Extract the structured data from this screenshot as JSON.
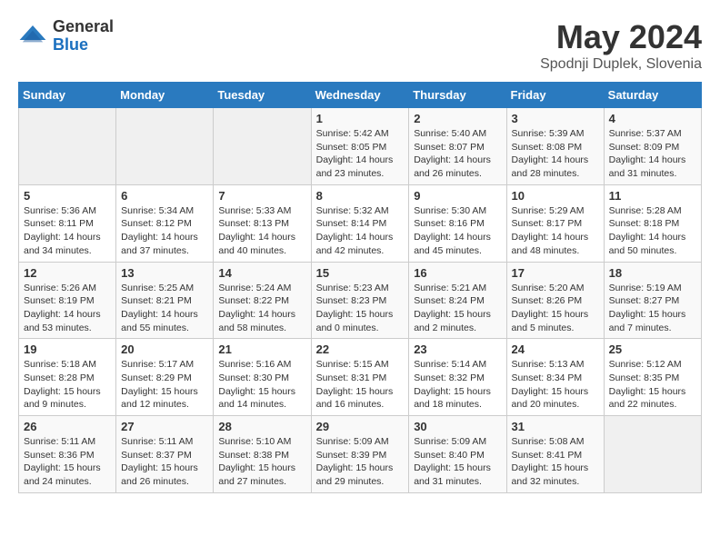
{
  "header": {
    "logo_general": "General",
    "logo_blue": "Blue",
    "title": "May 2024",
    "subtitle": "Spodnji Duplek, Slovenia"
  },
  "days_of_week": [
    "Sunday",
    "Monday",
    "Tuesday",
    "Wednesday",
    "Thursday",
    "Friday",
    "Saturday"
  ],
  "weeks": [
    [
      {
        "day": "",
        "sunrise": "",
        "sunset": "",
        "daylight": ""
      },
      {
        "day": "",
        "sunrise": "",
        "sunset": "",
        "daylight": ""
      },
      {
        "day": "",
        "sunrise": "",
        "sunset": "",
        "daylight": ""
      },
      {
        "day": "1",
        "sunrise": "Sunrise: 5:42 AM",
        "sunset": "Sunset: 8:05 PM",
        "daylight": "Daylight: 14 hours and 23 minutes."
      },
      {
        "day": "2",
        "sunrise": "Sunrise: 5:40 AM",
        "sunset": "Sunset: 8:07 PM",
        "daylight": "Daylight: 14 hours and 26 minutes."
      },
      {
        "day": "3",
        "sunrise": "Sunrise: 5:39 AM",
        "sunset": "Sunset: 8:08 PM",
        "daylight": "Daylight: 14 hours and 28 minutes."
      },
      {
        "day": "4",
        "sunrise": "Sunrise: 5:37 AM",
        "sunset": "Sunset: 8:09 PM",
        "daylight": "Daylight: 14 hours and 31 minutes."
      }
    ],
    [
      {
        "day": "5",
        "sunrise": "Sunrise: 5:36 AM",
        "sunset": "Sunset: 8:11 PM",
        "daylight": "Daylight: 14 hours and 34 minutes."
      },
      {
        "day": "6",
        "sunrise": "Sunrise: 5:34 AM",
        "sunset": "Sunset: 8:12 PM",
        "daylight": "Daylight: 14 hours and 37 minutes."
      },
      {
        "day": "7",
        "sunrise": "Sunrise: 5:33 AM",
        "sunset": "Sunset: 8:13 PM",
        "daylight": "Daylight: 14 hours and 40 minutes."
      },
      {
        "day": "8",
        "sunrise": "Sunrise: 5:32 AM",
        "sunset": "Sunset: 8:14 PM",
        "daylight": "Daylight: 14 hours and 42 minutes."
      },
      {
        "day": "9",
        "sunrise": "Sunrise: 5:30 AM",
        "sunset": "Sunset: 8:16 PM",
        "daylight": "Daylight: 14 hours and 45 minutes."
      },
      {
        "day": "10",
        "sunrise": "Sunrise: 5:29 AM",
        "sunset": "Sunset: 8:17 PM",
        "daylight": "Daylight: 14 hours and 48 minutes."
      },
      {
        "day": "11",
        "sunrise": "Sunrise: 5:28 AM",
        "sunset": "Sunset: 8:18 PM",
        "daylight": "Daylight: 14 hours and 50 minutes."
      }
    ],
    [
      {
        "day": "12",
        "sunrise": "Sunrise: 5:26 AM",
        "sunset": "Sunset: 8:19 PM",
        "daylight": "Daylight: 14 hours and 53 minutes."
      },
      {
        "day": "13",
        "sunrise": "Sunrise: 5:25 AM",
        "sunset": "Sunset: 8:21 PM",
        "daylight": "Daylight: 14 hours and 55 minutes."
      },
      {
        "day": "14",
        "sunrise": "Sunrise: 5:24 AM",
        "sunset": "Sunset: 8:22 PM",
        "daylight": "Daylight: 14 hours and 58 minutes."
      },
      {
        "day": "15",
        "sunrise": "Sunrise: 5:23 AM",
        "sunset": "Sunset: 8:23 PM",
        "daylight": "Daylight: 15 hours and 0 minutes."
      },
      {
        "day": "16",
        "sunrise": "Sunrise: 5:21 AM",
        "sunset": "Sunset: 8:24 PM",
        "daylight": "Daylight: 15 hours and 2 minutes."
      },
      {
        "day": "17",
        "sunrise": "Sunrise: 5:20 AM",
        "sunset": "Sunset: 8:26 PM",
        "daylight": "Daylight: 15 hours and 5 minutes."
      },
      {
        "day": "18",
        "sunrise": "Sunrise: 5:19 AM",
        "sunset": "Sunset: 8:27 PM",
        "daylight": "Daylight: 15 hours and 7 minutes."
      }
    ],
    [
      {
        "day": "19",
        "sunrise": "Sunrise: 5:18 AM",
        "sunset": "Sunset: 8:28 PM",
        "daylight": "Daylight: 15 hours and 9 minutes."
      },
      {
        "day": "20",
        "sunrise": "Sunrise: 5:17 AM",
        "sunset": "Sunset: 8:29 PM",
        "daylight": "Daylight: 15 hours and 12 minutes."
      },
      {
        "day": "21",
        "sunrise": "Sunrise: 5:16 AM",
        "sunset": "Sunset: 8:30 PM",
        "daylight": "Daylight: 15 hours and 14 minutes."
      },
      {
        "day": "22",
        "sunrise": "Sunrise: 5:15 AM",
        "sunset": "Sunset: 8:31 PM",
        "daylight": "Daylight: 15 hours and 16 minutes."
      },
      {
        "day": "23",
        "sunrise": "Sunrise: 5:14 AM",
        "sunset": "Sunset: 8:32 PM",
        "daylight": "Daylight: 15 hours and 18 minutes."
      },
      {
        "day": "24",
        "sunrise": "Sunrise: 5:13 AM",
        "sunset": "Sunset: 8:34 PM",
        "daylight": "Daylight: 15 hours and 20 minutes."
      },
      {
        "day": "25",
        "sunrise": "Sunrise: 5:12 AM",
        "sunset": "Sunset: 8:35 PM",
        "daylight": "Daylight: 15 hours and 22 minutes."
      }
    ],
    [
      {
        "day": "26",
        "sunrise": "Sunrise: 5:11 AM",
        "sunset": "Sunset: 8:36 PM",
        "daylight": "Daylight: 15 hours and 24 minutes."
      },
      {
        "day": "27",
        "sunrise": "Sunrise: 5:11 AM",
        "sunset": "Sunset: 8:37 PM",
        "daylight": "Daylight: 15 hours and 26 minutes."
      },
      {
        "day": "28",
        "sunrise": "Sunrise: 5:10 AM",
        "sunset": "Sunset: 8:38 PM",
        "daylight": "Daylight: 15 hours and 27 minutes."
      },
      {
        "day": "29",
        "sunrise": "Sunrise: 5:09 AM",
        "sunset": "Sunset: 8:39 PM",
        "daylight": "Daylight: 15 hours and 29 minutes."
      },
      {
        "day": "30",
        "sunrise": "Sunrise: 5:09 AM",
        "sunset": "Sunset: 8:40 PM",
        "daylight": "Daylight: 15 hours and 31 minutes."
      },
      {
        "day": "31",
        "sunrise": "Sunrise: 5:08 AM",
        "sunset": "Sunset: 8:41 PM",
        "daylight": "Daylight: 15 hours and 32 minutes."
      },
      {
        "day": "",
        "sunrise": "",
        "sunset": "",
        "daylight": ""
      }
    ]
  ]
}
